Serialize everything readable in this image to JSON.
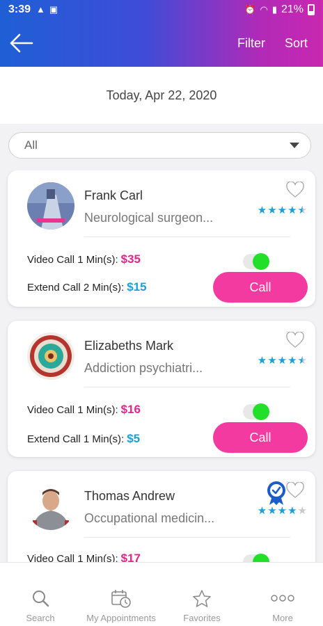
{
  "status_bar": {
    "time": "3:39",
    "battery": "21%"
  },
  "app_bar": {
    "filter_label": "Filter",
    "sort_label": "Sort"
  },
  "date_header": "Today, Apr 22, 2020",
  "dropdown": {
    "selected": "All"
  },
  "doctors": [
    {
      "name": "Frank Carl",
      "specialty": "Neurological surgeon...",
      "rating": 4.5,
      "video_call_label": "Video Call 1 Min(s):",
      "video_call_price": "$35",
      "extend_call_label": "Extend Call 2 Min(s):",
      "extend_call_price": "$15",
      "call_label": "Call"
    },
    {
      "name": "Elizabeths Mark",
      "specialty": "Addiction psychiatri...",
      "rating": 4.5,
      "video_call_label": "Video Call 1 Min(s):",
      "video_call_price": "$16",
      "extend_call_label": "Extend Call 1 Min(s):",
      "extend_call_price": "$5",
      "call_label": "Call"
    },
    {
      "name": "Thomas Andrew",
      "specialty": "Occupational medicin...",
      "rating": 4,
      "video_call_label": "Video Call 1 Min(s):",
      "video_call_price": "$17"
    }
  ],
  "bottom_nav": [
    {
      "label": "Search",
      "icon": "search-icon"
    },
    {
      "label": "My Appointments",
      "icon": "calendar-clock-icon"
    },
    {
      "label": "Favorites",
      "icon": "star-outline-icon"
    },
    {
      "label": "More",
      "icon": "more-dots-icon"
    }
  ],
  "colors": {
    "gradient_start": "#1f5fd6",
    "gradient_end": "#c928b0",
    "call_button": "#f23aa0",
    "price_pink": "#e0258b",
    "price_blue": "#1b9fd8",
    "online": "#22e02a",
    "star": "#1b9fd8"
  }
}
